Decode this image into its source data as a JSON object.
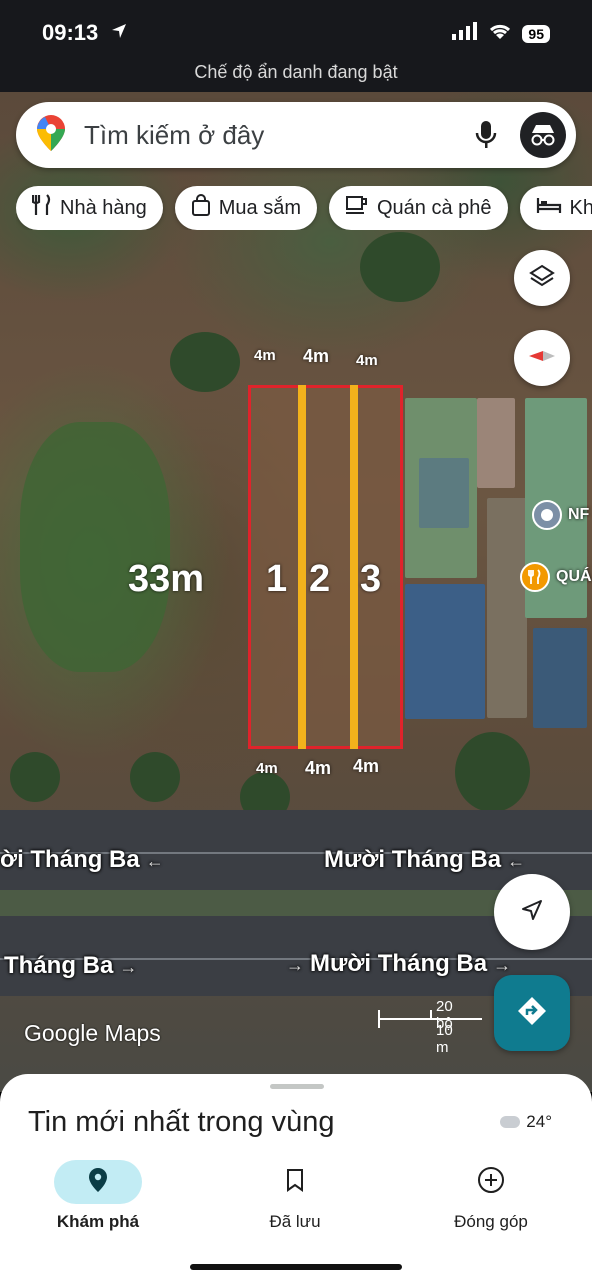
{
  "status_bar": {
    "time": "09:13",
    "battery": "95",
    "incognito_notice": "Chế độ ẩn danh đang bật"
  },
  "search": {
    "placeholder": "Tìm kiếm ở đây",
    "icons": [
      "google-maps-pin-icon",
      "mic-icon",
      "incognito-icon"
    ]
  },
  "chips": [
    {
      "label": "Nhà hàng",
      "icon": "fork-knife-icon"
    },
    {
      "label": "Mua sắm",
      "icon": "shopping-bag-icon"
    },
    {
      "label": "Quán cà phê",
      "icon": "coffee-cup-icon"
    },
    {
      "label": "Khá",
      "icon": "bed-icon"
    }
  ],
  "map": {
    "dimensions": {
      "top_left": "4m",
      "top_mid": "4m",
      "top_right": "4m",
      "bottom_left": "4m",
      "bottom_mid": "4m",
      "bottom_right": "4m",
      "depth": "33m"
    },
    "lots": [
      "1",
      "2",
      "3"
    ],
    "roads": {
      "upper_left": "ời Tháng Ba",
      "upper_right": "Mười Tháng Ba",
      "lower_left": "Tháng Ba",
      "lower_right": "Mười Tháng Ba"
    },
    "pois": [
      {
        "label": "NF",
        "color": "#7c8fa6"
      },
      {
        "label": "QUÁ",
        "color": "#f29900"
      }
    ],
    "watermark": "Google Maps",
    "scale": {
      "top": "20 bộ",
      "bottom": "10 m"
    },
    "colors": {
      "plot_outline": "#e0232b",
      "divider": "#f2b21c",
      "directions": "#0f7b8f"
    }
  },
  "sheet": {
    "title": "Tin mới nhất trong vùng",
    "weather": "24°"
  },
  "nav": [
    {
      "label": "Khám phá",
      "icon": "location-pin-icon",
      "active": true
    },
    {
      "label": "Đã lưu",
      "icon": "bookmark-icon",
      "active": false
    },
    {
      "label": "Đóng góp",
      "icon": "plus-circle-icon",
      "active": false
    }
  ]
}
